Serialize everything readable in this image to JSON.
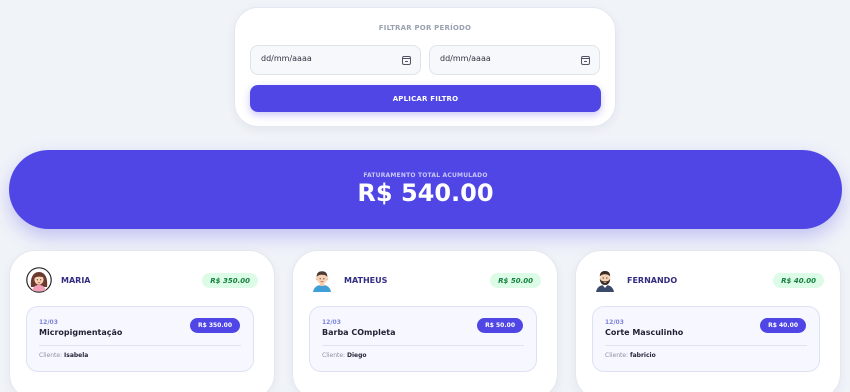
{
  "filter": {
    "title": "FILTRAR POR PERÍODO",
    "start_placeholder": "dd/mm/aaaa",
    "end_placeholder": "dd/mm/aaaa",
    "apply_label": "APLICAR FILTRO"
  },
  "revenue": {
    "label": "FATURAMENTO TOTAL ACUMULADO",
    "value": "R$ 540.00"
  },
  "colors": {
    "accent": "#4f46e5",
    "background": "#f0f3f8",
    "badge_green_bg": "#dcfce7",
    "badge_green_text": "#15803d"
  },
  "barbers": [
    {
      "name": "MARIA",
      "avatar_icon": "woman-avatar-icon",
      "total": "R$ 350.00",
      "services": [
        {
          "date": "12/03",
          "service": "Micropigmentação",
          "price": "R$ 350.00",
          "client_label": "Cliente:",
          "client": "Isabela"
        }
      ]
    },
    {
      "name": "MATHEUS",
      "avatar_icon": "man-avatar-icon",
      "total": "R$ 50.00",
      "services": [
        {
          "date": "12/03",
          "service": "Barba COmpleta",
          "price": "R$ 50.00",
          "client_label": "Cliente:",
          "client": "Diego"
        }
      ]
    },
    {
      "name": "FERNANDO",
      "avatar_icon": "bearded-man-avatar-icon",
      "total": "R$ 40.00",
      "services": [
        {
          "date": "12/03",
          "service": "Corte Masculinho",
          "price": "R$ 40.00",
          "client_label": "Cliente:",
          "client": "fabricio"
        }
      ]
    }
  ]
}
